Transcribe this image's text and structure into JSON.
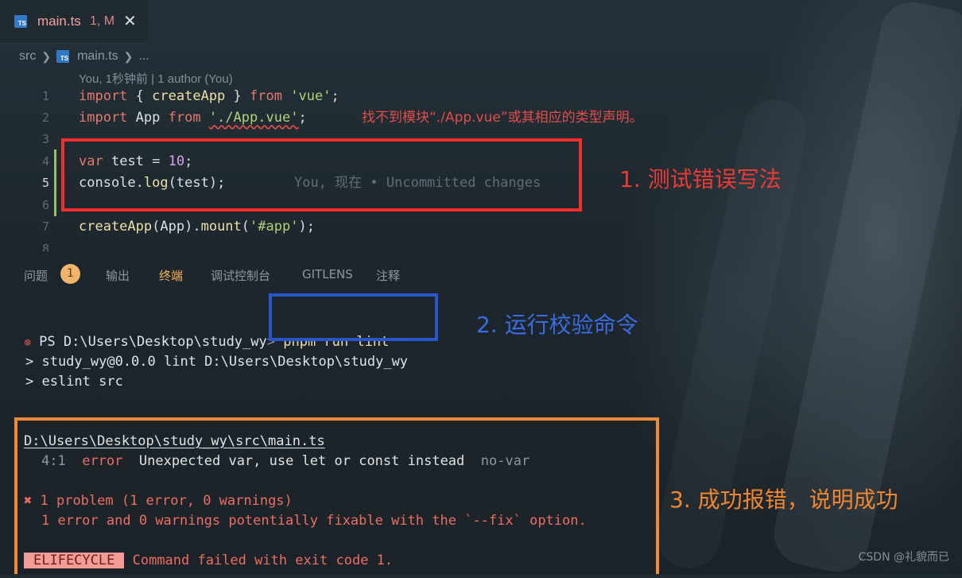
{
  "tab": {
    "name": "main.ts",
    "status": "1, M",
    "icon": "ts-file-icon",
    "close_glyph": "✕"
  },
  "breadcrumb": {
    "folder": "src",
    "file": "main.ts",
    "more": "..."
  },
  "blame_header": "You, 1秒钟前 | 1 author (You)",
  "editor": {
    "line_numbers": [
      "1",
      "2",
      "3",
      "4",
      "5",
      "6",
      "7",
      "8"
    ],
    "diagnostic": "找不到模块“./App.vue”或其相应的类型声明。",
    "inline_blame": "You, 现在 • Uncommitted changes",
    "tokens": {
      "import": "import",
      "lbrace": "{",
      "createApp": "createApp",
      "rbrace": "}",
      "from": "from",
      "vue_str": "'vue'",
      "semi": ";",
      "App": "App",
      "app_vue_str": "'./App.vue'",
      "var": "var",
      "test": "test",
      "eq": "=",
      "ten": "10",
      "console": "console",
      "dot": ".",
      "log": "log",
      "lparen": "(",
      "rparen": ")",
      "mount": "mount",
      "app_sel": "'#app'"
    }
  },
  "annotations": {
    "step1": "1. 测试错误写法",
    "step2": "2. 运行校验命令",
    "step3": "3. 成功报错，说明成功"
  },
  "panel": {
    "tabs": [
      {
        "label": "问题"
      },
      {
        "label": "输出"
      },
      {
        "label": "终端"
      },
      {
        "label": "调试控制台"
      },
      {
        "label": "GITLENS"
      },
      {
        "label": "注释"
      }
    ],
    "problems_count": "1",
    "active_tab": "终端"
  },
  "terminal": {
    "prompt": "PS D:\\Users\\Desktop\\study_wy",
    "prompt_arrow": ">",
    "command": "pnpm run lint",
    "out1": "> study_wy@0.0.0 lint D:\\Users\\Desktop\\study_wy",
    "out2": "> eslint src",
    "file_path": "D:\\Users\\Desktop\\study_wy\\src\\main.ts",
    "err_pos": "4:1",
    "err_level": "error",
    "err_msg": "Unexpected var, use let or const instead",
    "err_rule": "no-var",
    "problems_icon": "✖",
    "problems": "1 problem (1 error, 0 warnings)",
    "fixable": "1 error and 0 warnings potentially fixable with the `--fix` option.",
    "elifecycle": "ELIFECYCLE",
    "failed_msg": "Command failed with exit code 1."
  },
  "watermark": "CSDN @礼貌而已",
  "colors": {
    "red_box": "#ee2f2f",
    "blue_box": "#2b56c9",
    "orange_box": "#f28b38",
    "accent_tab": "#f1b15e"
  }
}
